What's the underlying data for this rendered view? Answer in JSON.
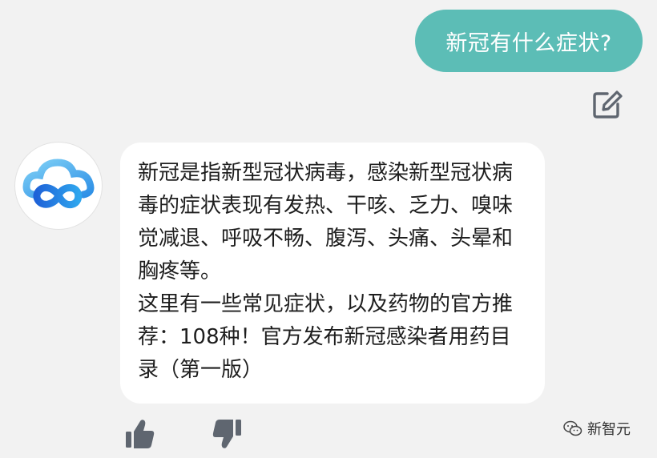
{
  "user_message": {
    "text": "新冠有什么症状?"
  },
  "bot_message": {
    "paragraph_1": "新冠是指新型冠状病毒，感染新型冠状病毒的症状表现有发热、干咳、乏力、嗅味觉减退、呼吸不畅、腹泻、头痛、头晕和胸疼等。",
    "paragraph_2": "这里有一些常见症状，以及药物的官方推荐：108种！官方发布新冠感染者用药目录（第一版）"
  },
  "icons": {
    "edit": "edit-icon",
    "avatar": "cloud-infinity-logo",
    "like": "thumbs-up-icon",
    "dislike": "thumbs-down-icon",
    "watermark": "wechat-icon"
  },
  "watermark": {
    "text": "新智元"
  },
  "colors": {
    "background": "#f2f2f2",
    "user_bubble": "#5cbdb6",
    "bot_bubble": "#ffffff",
    "icon_gray": "#5f6670",
    "logo_blue": "#2a8ee6"
  }
}
